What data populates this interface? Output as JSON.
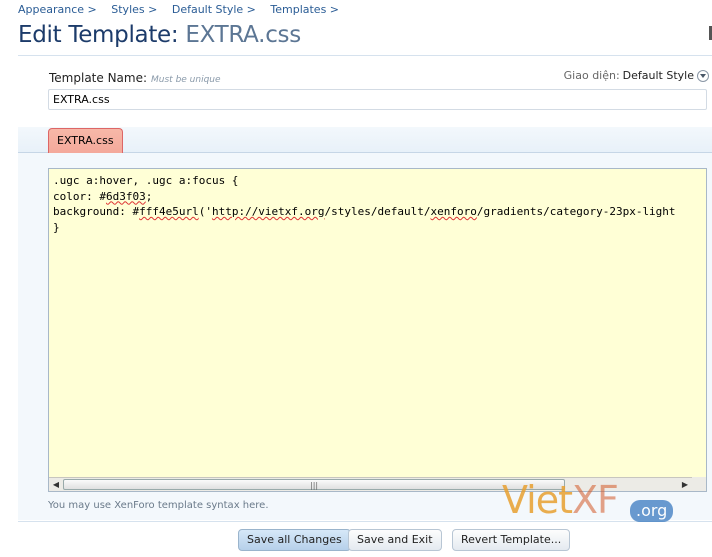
{
  "breadcrumbs": [
    "Appearance >",
    "Styles >",
    "Default Style >",
    "Templates >"
  ],
  "page_title": {
    "prefix": "Edit Template:",
    "file": "EXTRA.css"
  },
  "template_name": {
    "label": "Template Name:",
    "hint": "Must be unique",
    "value": "EXTRA.css"
  },
  "style_selector": {
    "label": "Giao diện:",
    "value": "Default Style"
  },
  "tab": {
    "label": "EXTRA.css"
  },
  "code": {
    "line1": ".ugc a:hover, .ugc a:focus {",
    "line2_prefix": "color: #",
    "line2_word": "6d3f03",
    "line2_suffix": ";",
    "line3_a": "background: #",
    "line3_b": "fff4e5url",
    "line3_c": "('",
    "line3_d": "http://vietxf.org",
    "line3_e": "/styles/default/",
    "line3_f": "xenforo",
    "line3_g": "/gradients/category-23px-light",
    "line4": "}"
  },
  "syntax_hint": "You may use XenForo template syntax here.",
  "buttons": {
    "save_all": "Save all Changes",
    "save_exit": "Save and Exit",
    "revert": "Revert Template..."
  },
  "watermark": {
    "brand_a": "Viet",
    "brand_b": "XF",
    "tld": ".org"
  },
  "colors": {
    "link": "#2a5c95",
    "editor_bg": "#ffffd6",
    "tab_bg": "#f4a89a",
    "primary_button": "#b6d0ea"
  },
  "icons": {
    "style_dropdown": "chevron-down-icon"
  }
}
